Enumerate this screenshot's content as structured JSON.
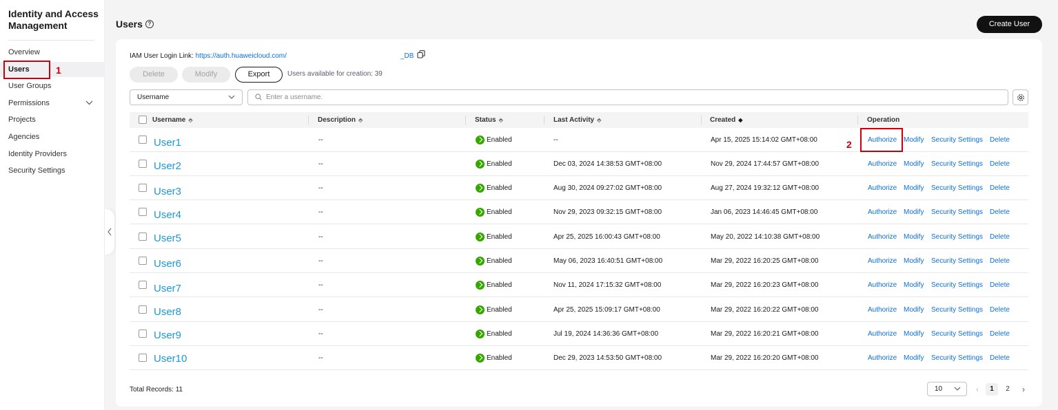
{
  "sidebar": {
    "title": "Identity and Access Management",
    "items": [
      {
        "label": "Overview"
      },
      {
        "label": "Users"
      },
      {
        "label": "User Groups"
      },
      {
        "label": "Permissions"
      },
      {
        "label": "Projects"
      },
      {
        "label": "Agencies"
      },
      {
        "label": "Identity Providers"
      },
      {
        "label": "Security Settings"
      }
    ],
    "active_item": "Users"
  },
  "annotations": {
    "step1": "1",
    "step2": "2",
    "color": "#c7000b"
  },
  "header": {
    "title": "Users",
    "help_icon": "question-circle-icon",
    "create_button": "Create User"
  },
  "toolbar": {
    "login_link_label": "IAM User Login Link: ",
    "login_link_url": "https://auth.huaweicloud.com/",
    "login_link_tail": "_DB",
    "copy_icon": "copy-icon",
    "delete_button": "Delete",
    "modify_button": "Modify",
    "export_button": "Export",
    "available_text": "Users available for creation: 39"
  },
  "filter": {
    "field_select": "Username",
    "search_placeholder": "Enter a username.",
    "settings_icon": "gear-icon"
  },
  "table": {
    "columns": [
      "Username",
      "Description",
      "Status",
      "Last Activity",
      "Created",
      "Operation"
    ],
    "rows": [
      {
        "username": "User1",
        "description": "--",
        "status": "Enabled",
        "last_activity": "--",
        "created": "Apr 15, 2025 15:14:02 GMT+08:00"
      },
      {
        "username": "User2",
        "description": "--",
        "status": "Enabled",
        "last_activity": "Dec 03, 2024 14:38:53 GMT+08:00",
        "created": "Nov 29, 2024 17:44:57 GMT+08:00"
      },
      {
        "username": "User3",
        "description": "--",
        "status": "Enabled",
        "last_activity": "Aug 30, 2024 09:27:02 GMT+08:00",
        "created": "Aug 27, 2024 19:32:12 GMT+08:00"
      },
      {
        "username": "User4",
        "description": "--",
        "status": "Enabled",
        "last_activity": "Nov 29, 2023 09:32:15 GMT+08:00",
        "created": "Jan 06, 2023 14:46:45 GMT+08:00"
      },
      {
        "username": "User5",
        "description": "--",
        "status": "Enabled",
        "last_activity": "Apr 25, 2025 16:00:43 GMT+08:00",
        "created": "May 20, 2022 14:10:38 GMT+08:00"
      },
      {
        "username": "User6",
        "description": "--",
        "status": "Enabled",
        "last_activity": "May 06, 2023 16:40:51 GMT+08:00",
        "created": "Mar 29, 2022 16:20:25 GMT+08:00"
      },
      {
        "username": "User7",
        "description": "--",
        "status": "Enabled",
        "last_activity": "Nov 11, 2024 17:15:32 GMT+08:00",
        "created": "Mar 29, 2022 16:20:23 GMT+08:00"
      },
      {
        "username": "User8",
        "description": "--",
        "status": "Enabled",
        "last_activity": "Apr 25, 2025 15:09:17 GMT+08:00",
        "created": "Mar 29, 2022 16:20:22 GMT+08:00"
      },
      {
        "username": "User9",
        "description": "--",
        "status": "Enabled",
        "last_activity": "Jul 19, 2024 14:36:36 GMT+08:00",
        "created": "Mar 29, 2022 16:20:21 GMT+08:00"
      },
      {
        "username": "User10",
        "description": "--",
        "status": "Enabled",
        "last_activity": "Dec 29, 2023 14:53:50 GMT+08:00",
        "created": "Mar 29, 2022 16:20:20 GMT+08:00"
      }
    ],
    "operations": [
      "Authorize",
      "Modify",
      "Security Settings",
      "Delete"
    ]
  },
  "footer": {
    "total_records": "Total Records: 11",
    "page_size": "10",
    "pages": [
      "1",
      "2"
    ],
    "current_page": "1"
  },
  "colors": {
    "link": "#0c6ed9",
    "username": "#1a9ad6",
    "status_enabled": "#37a600",
    "primary_button": "#111111"
  }
}
